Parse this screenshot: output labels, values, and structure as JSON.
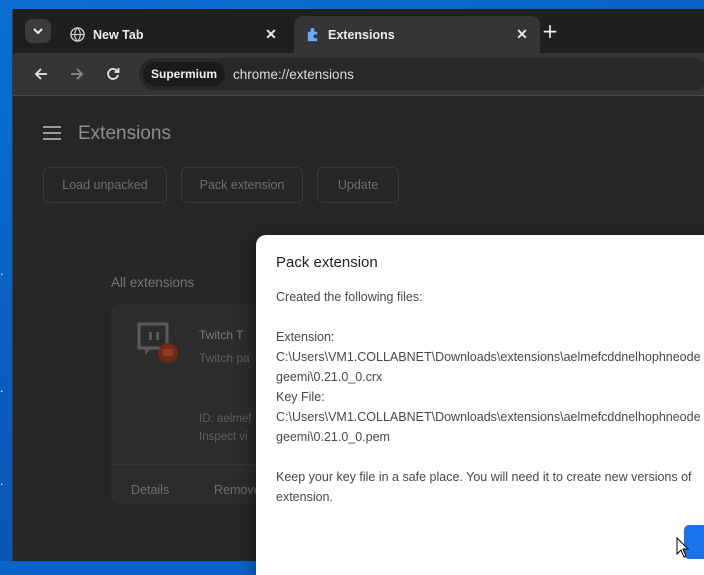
{
  "browser": {
    "tabs": [
      {
        "label": "New Tab",
        "icon": "globe-icon",
        "active": false
      },
      {
        "label": "Extensions",
        "icon": "puzzle-icon",
        "active": true
      }
    ],
    "address": {
      "chip": "Supermium",
      "url": "chrome://extensions"
    }
  },
  "extensions_page": {
    "title": "Extensions",
    "buttons": {
      "load_unpacked": "Load unpacked",
      "pack_extension": "Pack extension",
      "update": "Update"
    },
    "section_title": "All extensions",
    "card": {
      "name": "Twitch T",
      "description": "Twitch pa",
      "id": "ID: aelmef",
      "inspect": "Inspect vi",
      "details": "Details",
      "remove": "Remove"
    }
  },
  "dialog": {
    "title": "Pack extension",
    "line1": "Created the following files:",
    "ext_label": "Extension:",
    "ext_path_1": "C:\\Users\\VM1.COLLABNET\\Downloads\\extensions\\aelmefcddnelhophneode",
    "ext_path_2": "geemi\\0.21.0_0.crx",
    "key_label": "Key File:",
    "key_path_1": "C:\\Users\\VM1.COLLABNET\\Downloads\\extensions\\aelmefcddnelhophneode",
    "key_path_2": "geemi\\0.21.0_0.pem",
    "note_1": "Keep your key file in a safe place. You will need it to create new versions of",
    "note_2": "extension."
  },
  "colors": {
    "accent": "#1a73e8",
    "dialog_bg": "#ffffff",
    "page_bg": "#262626",
    "desktop": "#0a64c8"
  }
}
